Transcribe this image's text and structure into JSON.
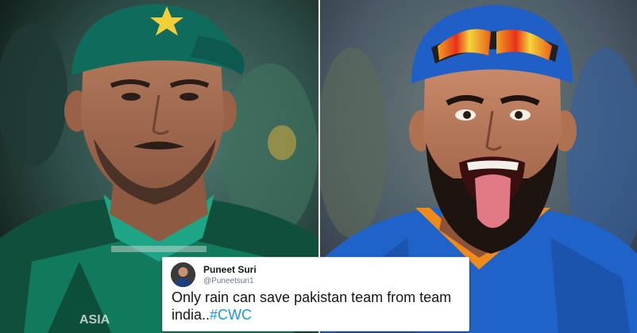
{
  "tweet": {
    "user_name": "Puneet Suri",
    "handle": "@Puneetsuri1",
    "text": "Only rain can save pakistan team from team india..",
    "hashtag": "#CWC",
    "hashtag_color": "#1b95e0"
  },
  "images": {
    "left": "pakistan-cricketer-photo",
    "right": "india-cricketer-photo"
  },
  "jersey_logo": "ASIA"
}
